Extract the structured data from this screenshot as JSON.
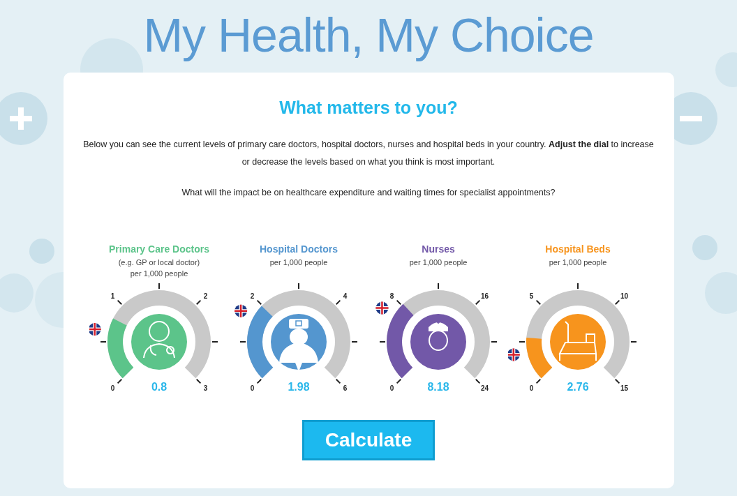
{
  "title": "My Health, My Choice",
  "heading": "What matters to you?",
  "intro": "Below you can see the current levels of primary care doctors, hospital doctors, nurses and hospital beds in your country. **Adjust the dial** to increase or decrease the levels based on what you think is most important.",
  "question": "What will the impact be on healthcare expenditure and waiting times for specialist appointments?",
  "dials": [
    {
      "name": "Primary Care Doctors",
      "note": "(e.g. GP or local doctor)",
      "unit": "per 1,000 people",
      "color": "#5cc48a",
      "kind": "doctor",
      "value": "0.8",
      "ticks": [
        "1",
        "2",
        "0",
        "3"
      ]
    },
    {
      "name": "Hospital Doctors",
      "unit": "per 1,000 people",
      "color": "#5496cf",
      "kind": "surgeon",
      "value": "1.98",
      "ticks": [
        "2",
        "4",
        "0",
        "6"
      ]
    },
    {
      "name": "Nurses",
      "unit": "per 1,000 people",
      "color": "#7258a8",
      "kind": "nurse",
      "value": "8.18",
      "ticks": [
        "8",
        "16",
        "0",
        "24"
      ]
    },
    {
      "name": "Hospital Beds",
      "unit": "per 1,000 people",
      "color": "#f7941d",
      "kind": "bed",
      "value": "2.76",
      "ticks": [
        "5",
        "10",
        "0",
        "15"
      ]
    }
  ],
  "button": "Calculate"
}
